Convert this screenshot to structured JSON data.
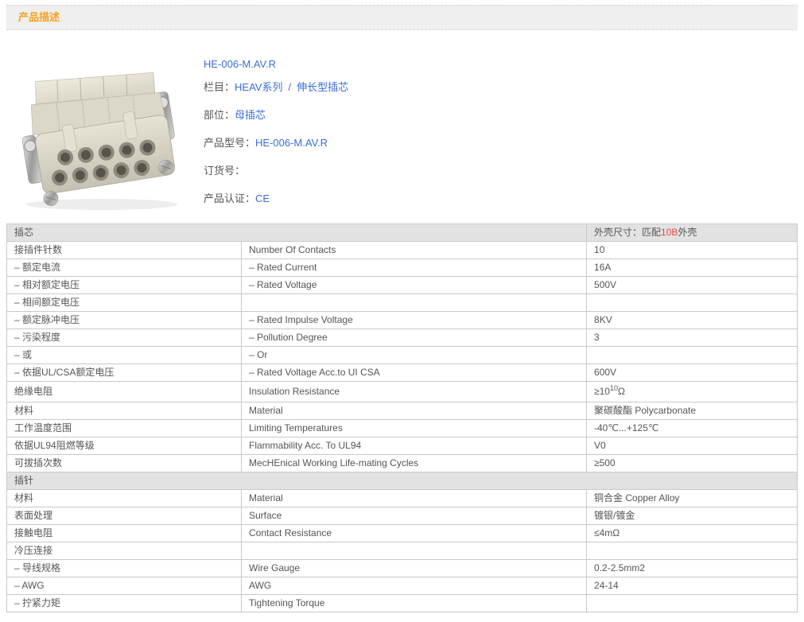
{
  "header_bar": {
    "title": "产品描述"
  },
  "product": {
    "name_link": "HE-006-M.AV.R",
    "category": {
      "label": "栏目：",
      "link1": "HEAV系列",
      "sep": "/",
      "link2": "伸长型插芯"
    },
    "part": {
      "label": "部位：",
      "link": "母插芯"
    },
    "model": {
      "label": "产品型号：",
      "link": "HE-006-M.AV.R"
    },
    "order_no": {
      "label": "订货号：",
      "value": ""
    },
    "certification": {
      "label": "产品认证：",
      "link": "CE"
    }
  },
  "spec_table": {
    "sections": [
      {
        "title": "插芯",
        "title_right": {
          "pre": "外壳尺寸：匹配",
          "highlight": "10B",
          "post": "外壳"
        },
        "rows": [
          [
            "接插件针数",
            "Number Of Contacts",
            "10"
          ],
          [
            "– 额定电流",
            "– Rated Current",
            "16A"
          ],
          [
            "– 相对额定电压",
            "– Rated Voltage",
            "500V"
          ],
          [
            "– 相间额定电压",
            "",
            ""
          ],
          [
            "– 额定脉冲电压",
            "– Rated Impulse Voltage",
            "8KV"
          ],
          [
            "– 污染程度",
            "– Pollution Degree",
            "3"
          ],
          [
            "– 或",
            "– Or",
            ""
          ],
          [
            "– 依据UL/CSA额定电压",
            "– Rated Voltage Acc.to UI CSA",
            "600V"
          ],
          [
            "绝缘电阻",
            "Insulation Resistance",
            {
              "pre": "≥10",
              "sup": "10",
              "post": "Ω"
            }
          ],
          [
            "材料",
            "Material",
            "聚碳酸酯 Polycarbonate"
          ],
          [
            "工作温度范围",
            "Limiting Temperatures",
            "-40℃...+125℃"
          ],
          [
            "依据UL94阻燃等级",
            "Flammability Acc. To UL94",
            "V0"
          ],
          [
            "可拔插次数",
            "MecHEnical Working Life-mating Cycles",
            "≥500"
          ]
        ]
      },
      {
        "title": "插针",
        "rows": [
          [
            "材料",
            "Material",
            "铜合金 Copper Alloy"
          ],
          [
            "表面处理",
            "Surface",
            "镀银/镀金"
          ],
          [
            "接触电阻",
            "Contact Resistance",
            "≤4mΩ"
          ],
          [
            "冷压连接",
            "",
            ""
          ],
          [
            "– 导线规格",
            "Wire Gauge",
            "0.2-2.5mm2"
          ],
          [
            "– AWG",
            "AWG",
            "24-14"
          ],
          [
            "– 拧紧力矩",
            "Tightening Torque",
            ""
          ]
        ]
      }
    ]
  },
  "colors": {
    "accent_orange": "#f9a11b",
    "link_blue": "#3a6fd8",
    "highlight_red": "#e64545",
    "section_bg": "#e2e2e2",
    "border": "#c9c9c9"
  }
}
